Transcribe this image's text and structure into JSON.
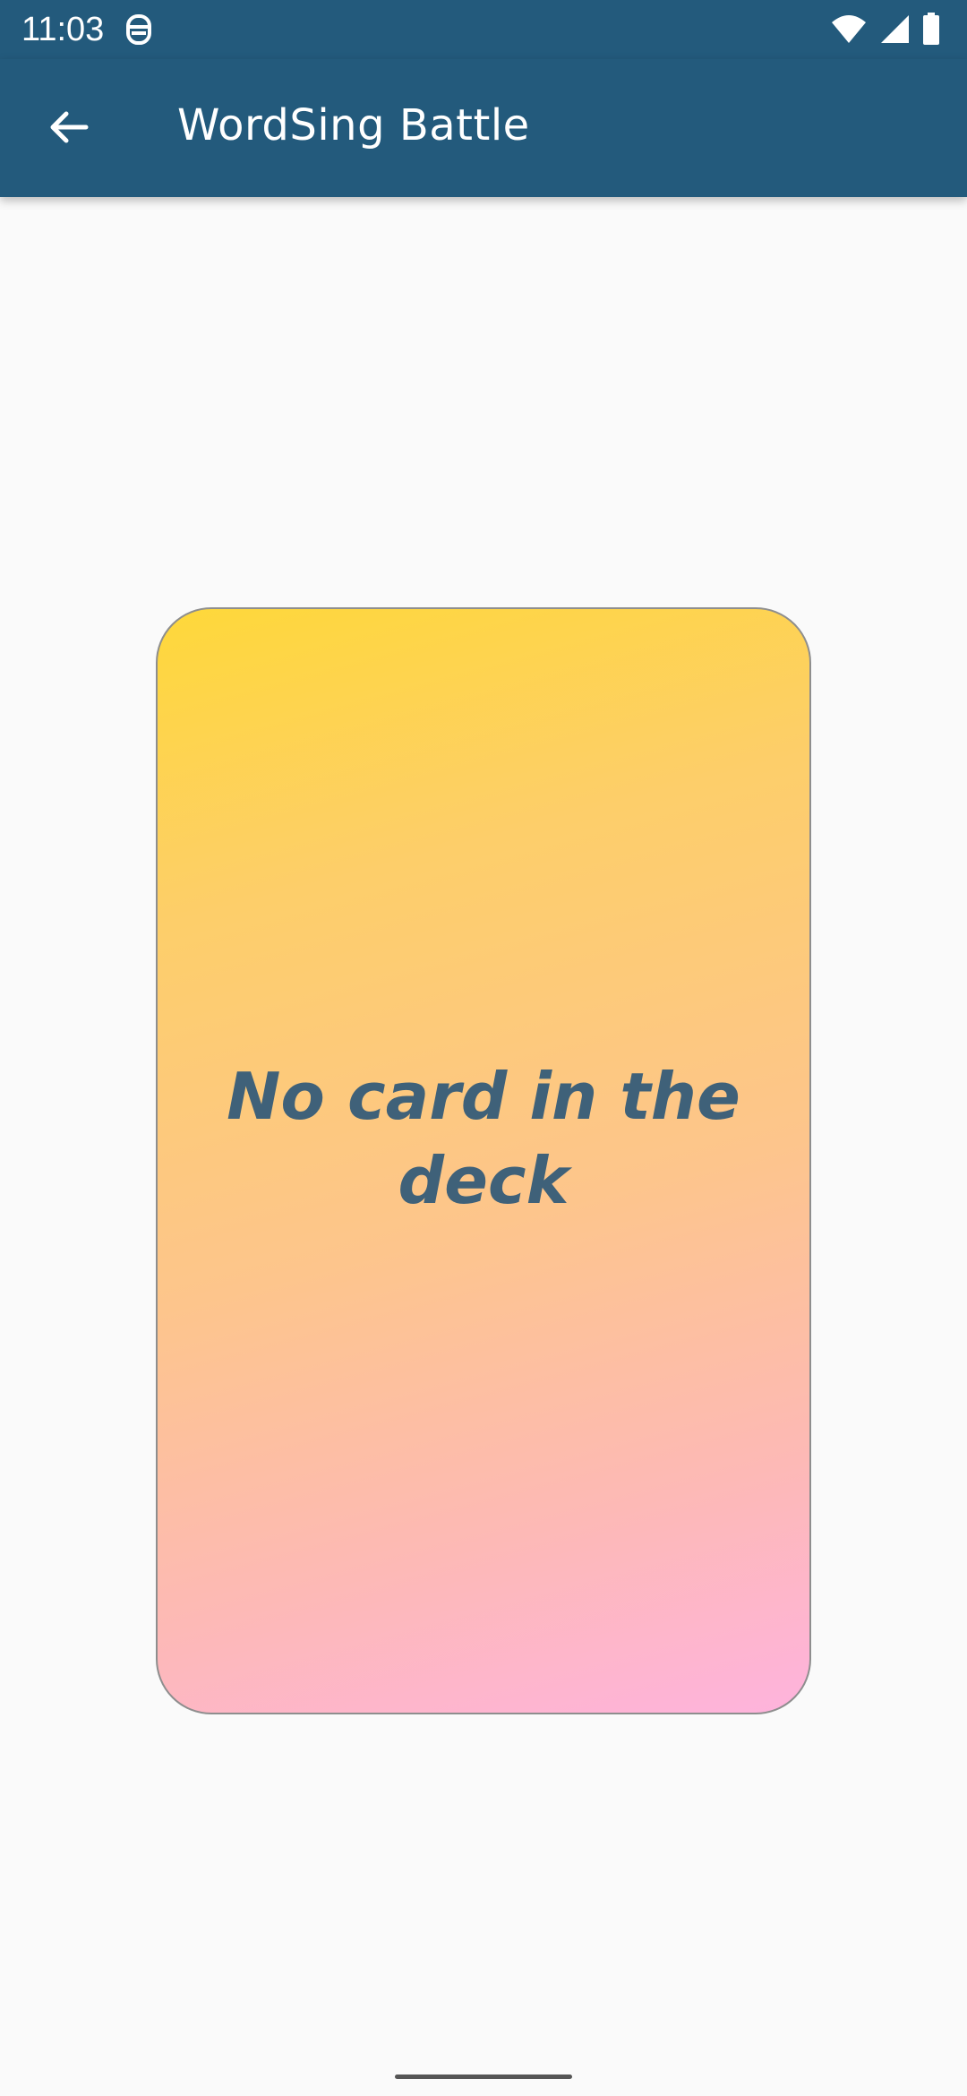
{
  "status_bar": {
    "time": "11:03",
    "left_icon": "notification-icon",
    "right_icons": [
      "wifi-icon",
      "signal-icon",
      "battery-icon"
    ]
  },
  "app_bar": {
    "back_icon": "arrow-back-icon",
    "title": "WordSing Battle"
  },
  "card": {
    "message": "No card in the deck"
  },
  "colors": {
    "app_bar": "#235a7c",
    "background": "#fafafa",
    "card_gradient_top": "#fed83a",
    "card_gradient_bottom": "#feb3dd",
    "card_text": "#3f6179"
  }
}
